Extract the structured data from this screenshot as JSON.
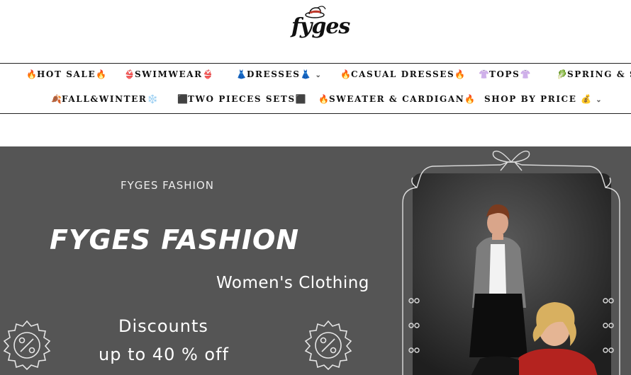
{
  "brand": {
    "logo_text": "fyges"
  },
  "nav": {
    "row1": [
      {
        "icon": "🔥",
        "label": "HOT SALE",
        "icon_after": "🔥"
      },
      {
        "icon": "👙",
        "label": "SWIMWEAR",
        "icon_after": "👙"
      },
      {
        "icon": "👗",
        "label": "DRESSES",
        "icon_after": "👗",
        "dropdown": true
      },
      {
        "icon": "🔥",
        "label": "CASUAL DRESSES",
        "icon_after": "🔥"
      },
      {
        "icon": "👚",
        "label": "TOPS",
        "icon_after": "👚"
      },
      {
        "icon": "🥬",
        "label": "SPRING & SU",
        "icon_after": ""
      }
    ],
    "row2": [
      {
        "icon": "🍂",
        "label": "FALL&WINTER",
        "icon_after": "❄️"
      },
      {
        "icon": "⬛",
        "label": "TWO PIECES SETS",
        "icon_after": "⬛"
      },
      {
        "icon": "🔥",
        "label": "SWEATER & CARDIGAN",
        "icon_after": "🔥"
      },
      {
        "icon": "",
        "label": "SHOP BY PRICE",
        "icon_after": "💰",
        "dropdown": true
      }
    ]
  },
  "hero": {
    "kicker": "FYGES FASHION",
    "title": "FYGES FASHION",
    "subtitle": "Women's Clothing",
    "discount_line1": "Discounts",
    "discount_line2": "up to 40 % off",
    "colors": {
      "background": "#555555",
      "text": "#ffffff"
    }
  }
}
